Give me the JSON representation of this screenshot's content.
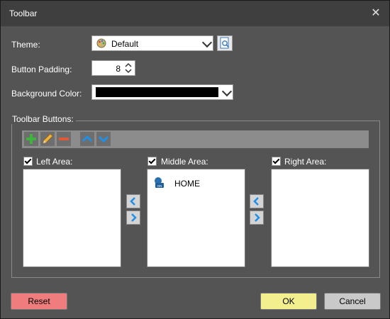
{
  "window": {
    "title": "Toolbar"
  },
  "theme": {
    "label": "Theme:",
    "value": "Default"
  },
  "padding": {
    "label": "Button Padding:",
    "value": "8"
  },
  "background": {
    "label": "Background Color:",
    "color": "#000000"
  },
  "toolbar_buttons": {
    "label": "Toolbar Buttons:",
    "left_area": {
      "label": "Left Area:",
      "checked": true,
      "items": []
    },
    "middle_area": {
      "label": "Middle Area:",
      "checked": true,
      "items": [
        {
          "label": "HOME",
          "icon": "home-app-icon"
        }
      ]
    },
    "right_area": {
      "label": "Right Area:",
      "checked": true,
      "items": []
    }
  },
  "buttons": {
    "reset": "Reset",
    "ok": "OK",
    "cancel": "Cancel"
  },
  "colors": {
    "reset": "#f07d7d",
    "ok": "#f3ef8f",
    "cancel": "#c9c9c9",
    "add": "#3fb23f",
    "remove": "#e05a3a",
    "accent": "#1e90e8"
  }
}
